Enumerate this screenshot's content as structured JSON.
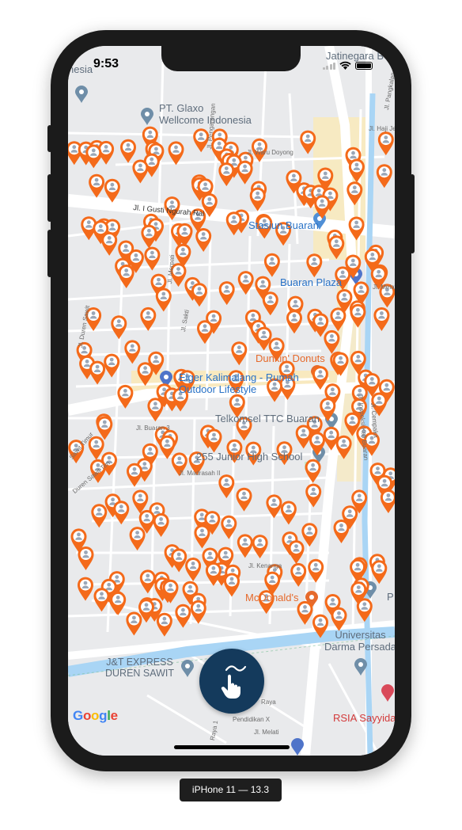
{
  "device_caption": "iPHone 11 — 13.3",
  "status_bar": {
    "time": "9:53"
  },
  "map": {
    "labels": {
      "nesia": "nesia",
      "jatinegara": "Jatinegara B",
      "pt_glaxo_line1": "PT. Glaxo",
      "pt_glaxo_line2": "Wellcome Indonesia",
      "stasiun_buaran": "Stasiun Buaran",
      "buaran_plaza": "Buaran Plaza",
      "dunkin": "Dunkin' Donuts",
      "eiger_line1": "Eiger Kalimalang - Rumah",
      "eiger_line2": "Outdoor Lifestyle",
      "telkomsel": "Telkomsel TTC Buaran",
      "junior_high": "255 Junior High School",
      "mcdonalds": "McDonald's",
      "universitas_line1": "Universitas",
      "universitas_line2": "Darma Persada",
      "jnt_line1": "J&T EXPRESS",
      "jnt_line2": "DUREN SAWIT",
      "rsia": "RSIA Sayyidah",
      "p_right": "P"
    },
    "streets": {
      "jl_gusti": "Jl. I Gusti Ngurah Rai",
      "waru_doyong": "Jl. Waru Doyong",
      "pengarengan": "Jl. Pengarengan",
      "merpati": "Jl. Merpati",
      "buaran3": "Jl. Buaran 3",
      "madrasah": "Jl. Madrasah II",
      "kenanga": "Jl. Kenanga",
      "pendidikan": "Pendidikan X",
      "melati_raya": "Jl. Melati Raya",
      "melati": "Jl. Melati",
      "inspeksi": "Jl. Inspeksi Kali Buaran",
      "cempaka": "Jl. Cempaka",
      "jl_pangkalan": "Jl. Pangkalan",
      "jl_haji_jebris": "Jl. Haji Jebris",
      "jl_kemuning": "Jl. Kemuning",
      "jl_sakti": "Jl. Sakti",
      "jl_duren_sawit": "Jl. Duren Sawit",
      "sawit_timur": "Sawit Timur",
      "duren_sawit_tim": "Duren Sawit Tim",
      "raya": "Raya",
      "raya1": "Raya 1"
    },
    "google_logo": {
      "G": "G",
      "o1": "o",
      "o2": "o",
      "g": "g",
      "l": "l",
      "e": "e"
    },
    "marker_icon": "person-pin-icon",
    "marker_color": "#f46a1a",
    "marker_count": 246
  },
  "fab": {
    "icon": "hand-pointer-gesture-icon",
    "color": "#143a5c"
  },
  "colors": {
    "road_major": "#ffffff",
    "highway": "#fbe9b4",
    "water": "#a9d5f5",
    "land": "#e9eaec",
    "brand_google_blue": "#4285f4",
    "brand_google_red": "#ea4335",
    "brand_google_yellow": "#fbbc05",
    "brand_google_green": "#34a853"
  }
}
